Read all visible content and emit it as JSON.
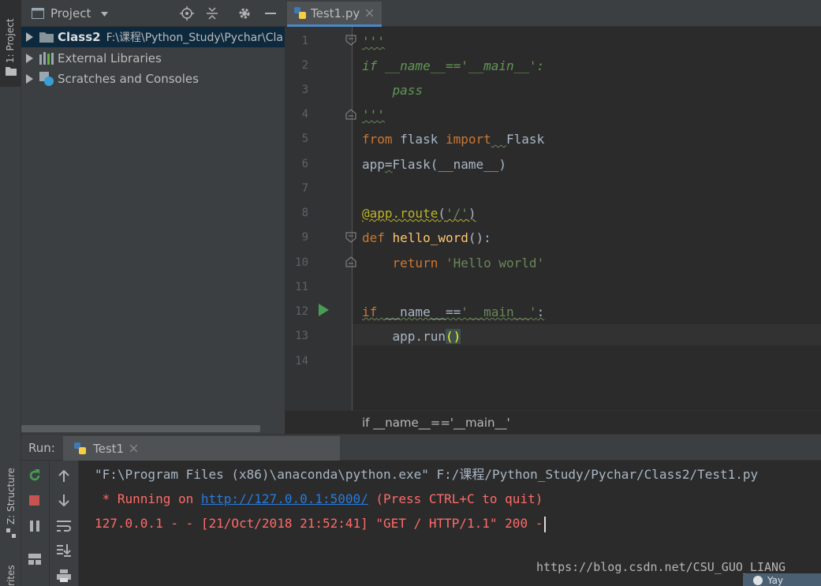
{
  "sidebar": {
    "project_tool": "1: Project",
    "structure_tool": "Z: Structure",
    "favorites_tool": "rites"
  },
  "project_panel": {
    "title": "Project",
    "tree": [
      {
        "name": "Class2",
        "path": "F:\\课程\\Python_Study\\Pychar\\Cla",
        "icon": "folder-icon",
        "selected": true
      },
      {
        "name": "External Libraries",
        "icon": "library-icon"
      },
      {
        "name": "Scratches and Consoles",
        "icon": "scratches-icon"
      }
    ]
  },
  "editor": {
    "tab_name": "Test1.py",
    "line_numbers": [
      "1",
      "2",
      "3",
      "4",
      "5",
      "6",
      "7",
      "8",
      "9",
      "10",
      "11",
      "12",
      "13",
      "14"
    ],
    "breadcrumb": "if __name__=='__main__'"
  },
  "run_panel": {
    "label": "Run:",
    "tab_name": "Test1",
    "console": {
      "line1": "\"F:\\Program Files (x86)\\anaconda\\python.exe\" F:/课程/Python_Study/Pychar/Class2/Test1.py",
      "line2_prefix": " * Running on ",
      "line2_link": "http://127.0.0.1:5000/",
      "line2_suffix": " (Press CTRL+C to quit)",
      "line3": "127.0.0.1 - - [21/Oct/2018 21:52:41] \"GET / HTTP/1.1\" 200 -"
    }
  },
  "watermark": "https://blog.csdn.net/CSU_GUO_LIANG",
  "corner_badge": "Yay",
  "colors": {
    "keyword": "#cc7832",
    "string": "#6a8759",
    "decorator": "#bbb529",
    "function": "#ffc66d",
    "console_error": "#ff6b68",
    "link": "#287bde"
  }
}
